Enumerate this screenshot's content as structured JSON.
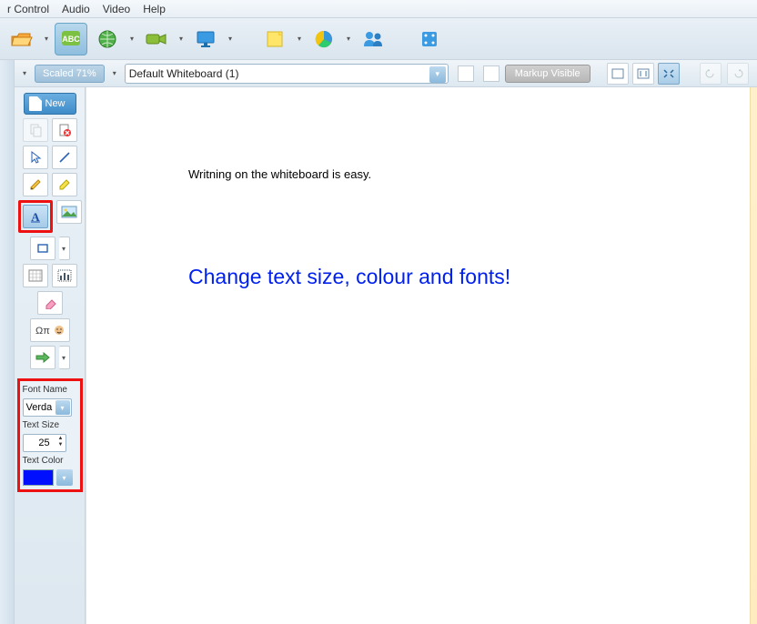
{
  "menu": {
    "control": "r Control",
    "audio": "Audio",
    "video": "Video",
    "help": "Help"
  },
  "subbar": {
    "scaled": "Scaled 71%",
    "whiteboard": "Default Whiteboard (1)",
    "markup": "Markup Visible"
  },
  "sidebar": {
    "new": "New",
    "font_name_label": "Font Name",
    "font_name_value": "Verda",
    "text_size_label": "Text Size",
    "text_size_value": "25",
    "text_color_label": "Text Color",
    "text_color_value": "#0010ff"
  },
  "canvas": {
    "line1": "Writning on the whiteboard is easy.",
    "line2": "Change text size, colour and fonts!"
  }
}
